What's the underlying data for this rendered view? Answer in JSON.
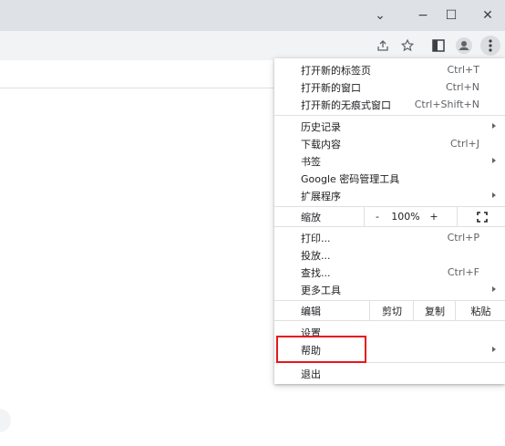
{
  "window_controls": {
    "dropdown": "⌄",
    "minimize": "−",
    "maximize": "☐",
    "close": "✕"
  },
  "toolbar_icons": [
    "share-icon",
    "bookmark-star-icon",
    "side-panel-icon",
    "profile-icon",
    "more-menu-icon"
  ],
  "menu": {
    "new_tab": {
      "label": "打开新的标签页",
      "shortcut": "Ctrl+T"
    },
    "new_window": {
      "label": "打开新的窗口",
      "shortcut": "Ctrl+N"
    },
    "incognito": {
      "label": "打开新的无痕式窗口",
      "shortcut": "Ctrl+Shift+N"
    },
    "history": {
      "label": "历史记录"
    },
    "downloads": {
      "label": "下载内容",
      "shortcut": "Ctrl+J"
    },
    "bookmarks": {
      "label": "书签"
    },
    "passwords": {
      "label": "Google 密码管理工具"
    },
    "extensions": {
      "label": "扩展程序"
    },
    "zoom": {
      "label": "缩放",
      "minus": "-",
      "value": "100%",
      "plus": "+"
    },
    "print": {
      "label": "打印...",
      "shortcut": "Ctrl+P"
    },
    "cast": {
      "label": "投放..."
    },
    "find": {
      "label": "查找...",
      "shortcut": "Ctrl+F"
    },
    "more_tools": {
      "label": "更多工具"
    },
    "edit": {
      "label": "编辑",
      "cut": "剪切",
      "copy": "复制",
      "paste": "粘贴"
    },
    "settings": {
      "label": "设置"
    },
    "help": {
      "label": "帮助"
    },
    "exit": {
      "label": "退出"
    }
  }
}
